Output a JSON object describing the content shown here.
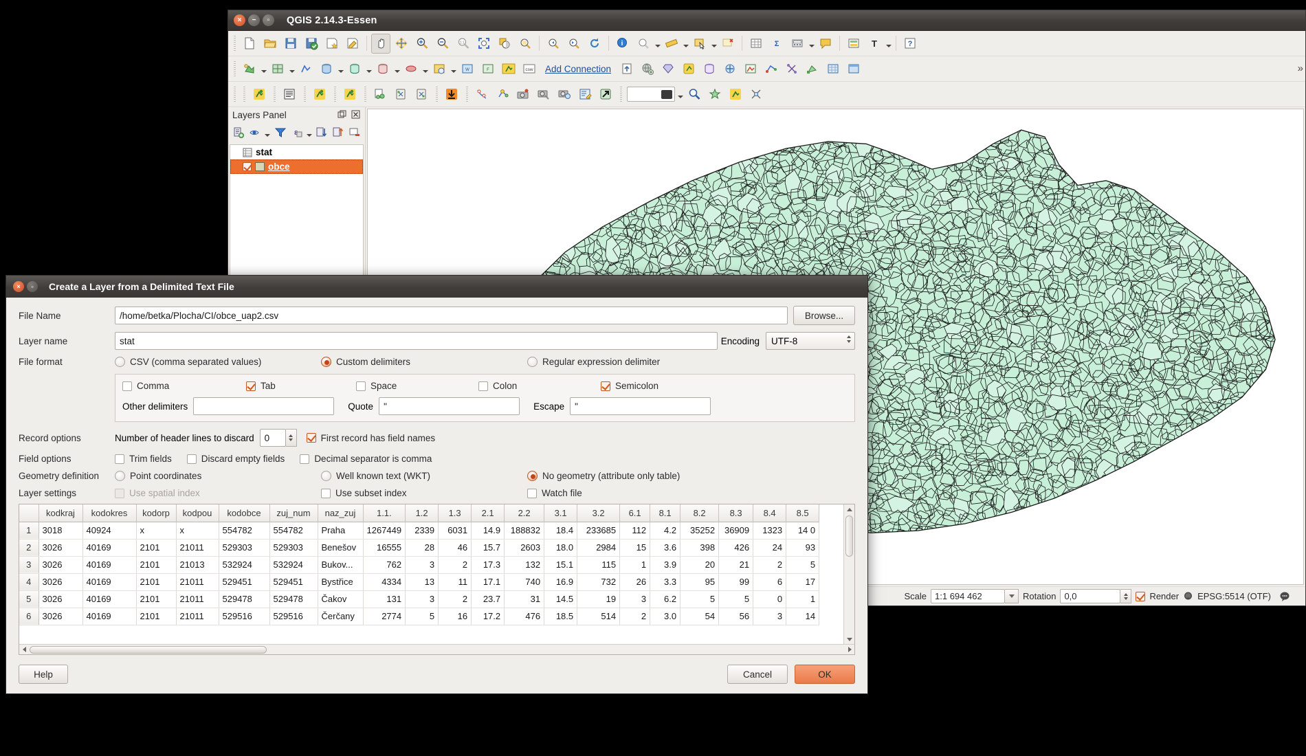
{
  "qgis": {
    "title": "QGIS 2.14.3-Essen",
    "window_buttons": {
      "close": "close-icon",
      "minimize": "minimize-icon",
      "maximize": "maximize-icon"
    },
    "toolbars": {
      "row1": [
        "new-project-icon",
        "open-project-icon",
        "save-project-icon",
        "save-project-as-icon",
        "new-print-composer-icon",
        "composer-manager-icon",
        "pan-map-icon",
        "pan-to-selection-icon",
        "zoom-in-icon",
        "zoom-out-icon",
        "zoom-full-icon",
        "zoom-native-icon",
        "zoom-to-selection-icon",
        "zoom-to-layer-icon",
        "zoom-last-icon",
        "zoom-next-icon",
        "refresh-icon",
        "identify-icon",
        "map-tips-icon",
        "measure-icon",
        "select-features-icon",
        "deselect-icon",
        "open-table-icon",
        "statistics-icon",
        "open-calculator-icon",
        "python-console-icon",
        "messages-icon",
        "style-icon",
        "label-icon",
        "help-icon"
      ],
      "row2": [
        "add-vector-layer-icon",
        "add-raster-layer-icon",
        "add-mesh-layer-icon",
        "add-postgis-layer-icon",
        "add-spatialite-layer-icon",
        "add-mssql-layer-icon",
        "add-oracle-layer-icon",
        "add-wms-layer-icon",
        "add-wcs-layer-icon",
        "add-wfs-layer-icon",
        "add-delimited-text-layer-icon",
        "add-csw-icon",
        "add-connection-label",
        "upload-icon",
        "globe-icon",
        "gem-icon",
        "plugin-icon",
        "db-manager-icon",
        "processing-icon",
        "georeferencer-icon",
        "topology-icon",
        "network-icon",
        "vector-icon",
        "raster-icon",
        "table-icon",
        "more-icon"
      ],
      "row3": [
        "plugin-green-icon",
        "text-doc-icon",
        "plugin-green-icon-2",
        "plugin-green-icon-3",
        "copy-style-icon",
        "paste-style-icon",
        "paste-style-2-icon",
        "download-icon",
        "node-tool-icon",
        "network-analysis-icon",
        "camera-pin-icon",
        "camera-tag-icon",
        "camera-db-icon",
        "edit-doc-icon",
        "export-arrow-icon"
      ],
      "add_connection_label": "Add Connection"
    },
    "layers_panel": {
      "title": "Layers Panel",
      "panel_buttons": [
        "undock-icon",
        "close-icon"
      ],
      "toolbar_icons": [
        "add-group-icon",
        "manage-visibility-icon",
        "filter-legend-icon",
        "expression-filter-icon",
        "options-dropdown-icon",
        "expand-all-icon",
        "collapse-all-icon",
        "remove-layer-icon"
      ],
      "layers": [
        {
          "name": "stat",
          "icon": "table-layer-icon",
          "selected": false,
          "checked": null
        },
        {
          "name": "obce",
          "icon": "polygon-layer-icon",
          "selected": true,
          "checked": true
        }
      ]
    },
    "statusbar": {
      "scale_label": "Scale",
      "scale_value": "1:1 694 462",
      "rotation_label": "Rotation",
      "rotation_value": "0,0",
      "render_label": "Render",
      "render_checked": true,
      "crs_label": "EPSG:5514 (OTF)",
      "crs_icon": "globe-icon",
      "messages_icon": "messages-bubble-icon"
    },
    "map": {
      "layer_fill": "#c8f0d8",
      "layer_stroke": "#1a1a1a",
      "background": "#ffffff"
    }
  },
  "dialog": {
    "title": "Create a Layer from a Delimited Text File",
    "file_name": {
      "label": "File Name",
      "value": "/home/betka/Plocha/CI/obce_uap2.csv",
      "browse_label": "Browse..."
    },
    "layer_name": {
      "label": "Layer name",
      "value": "stat"
    },
    "encoding": {
      "label": "Encoding",
      "value": "UTF-8"
    },
    "file_format": {
      "label": "File format",
      "options": [
        {
          "label": "CSV (comma separated values)",
          "selected": false
        },
        {
          "label": "Custom delimiters",
          "selected": true
        },
        {
          "label": "Regular expression delimiter",
          "selected": false
        }
      ]
    },
    "delimiters": {
      "checkboxes": [
        {
          "label": "Comma",
          "checked": false
        },
        {
          "label": "Tab",
          "checked": true
        },
        {
          "label": "Space",
          "checked": false
        },
        {
          "label": "Colon",
          "checked": false
        },
        {
          "label": "Semicolon",
          "checked": true
        }
      ],
      "other_label": "Other delimiters",
      "other_value": "",
      "quote_label": "Quote",
      "quote_value": "\"",
      "escape_label": "Escape",
      "escape_value": "\""
    },
    "record_options": {
      "label": "Record options",
      "header_lines_label": "Number of header lines to discard",
      "header_lines_value": "0",
      "first_record_label": "First record has field names",
      "first_record_checked": true
    },
    "field_options": {
      "label": "Field options",
      "items": [
        {
          "label": "Trim fields",
          "checked": false
        },
        {
          "label": "Discard empty fields",
          "checked": false
        },
        {
          "label": "Decimal separator is comma",
          "checked": false
        }
      ]
    },
    "geometry_definition": {
      "label": "Geometry definition",
      "options": [
        {
          "label": "Point coordinates",
          "selected": false
        },
        {
          "label": "Well known text (WKT)",
          "selected": false
        },
        {
          "label": "No geometry (attribute only table)",
          "selected": true
        }
      ]
    },
    "layer_settings": {
      "label": "Layer settings",
      "items": [
        {
          "label": "Use spatial index",
          "checked": false,
          "disabled": true
        },
        {
          "label": "Use subset index",
          "checked": false,
          "disabled": false
        },
        {
          "label": "Watch file",
          "checked": false,
          "disabled": false
        }
      ]
    },
    "preview_table": {
      "columns": [
        "kodkraj",
        "kodokres",
        "kodorp",
        "kodpou",
        "kodobce",
        "zuj_num",
        "naz_zuj",
        "1.1.",
        "1.2",
        "1.3",
        "2.1",
        "2.2",
        "3.1",
        "3.2",
        "6.1",
        "8.1",
        "8.2",
        "8.3",
        "8.4",
        "8.5"
      ],
      "rows": [
        {
          "n": "1",
          "cells": [
            "3018",
            "40924",
            "x",
            "x",
            "554782",
            "554782",
            "Praha",
            "1267449",
            "2339",
            "6031",
            "14.9",
            "188832",
            "18.4",
            "233685",
            "112",
            "4.2",
            "35252",
            "36909",
            "1323",
            "14 0"
          ]
        },
        {
          "n": "2",
          "cells": [
            "3026",
            "40169",
            "2101",
            "21011",
            "529303",
            "529303",
            "Benešov",
            "16555",
            "28",
            "46",
            "15.7",
            "2603",
            "18.0",
            "2984",
            "15",
            "3.6",
            "398",
            "426",
            "24",
            "93"
          ]
        },
        {
          "n": "3",
          "cells": [
            "3026",
            "40169",
            "2101",
            "21013",
            "532924",
            "532924",
            "Bukov...",
            "762",
            "3",
            "2",
            "17.3",
            "132",
            "15.1",
            "115",
            "1",
            "3.9",
            "20",
            "21",
            "2",
            "5"
          ]
        },
        {
          "n": "4",
          "cells": [
            "3026",
            "40169",
            "2101",
            "21011",
            "529451",
            "529451",
            "Bystřice",
            "4334",
            "13",
            "11",
            "17.1",
            "740",
            "16.9",
            "732",
            "26",
            "3.3",
            "95",
            "99",
            "6",
            "17"
          ]
        },
        {
          "n": "5",
          "cells": [
            "3026",
            "40169",
            "2101",
            "21011",
            "529478",
            "529478",
            "Čakov",
            "131",
            "3",
            "2",
            "23.7",
            "31",
            "14.5",
            "19",
            "3",
            "6.2",
            "5",
            "5",
            "0",
            "1"
          ]
        },
        {
          "n": "6",
          "cells": [
            "3026",
            "40169",
            "2101",
            "21011",
            "529516",
            "529516",
            "Čerčany",
            "2774",
            "5",
            "16",
            "17.2",
            "476",
            "18.5",
            "514",
            "2",
            "3.0",
            "54",
            "56",
            "3",
            "14"
          ]
        }
      ]
    },
    "buttons": {
      "help": "Help",
      "cancel": "Cancel",
      "ok": "OK"
    }
  }
}
